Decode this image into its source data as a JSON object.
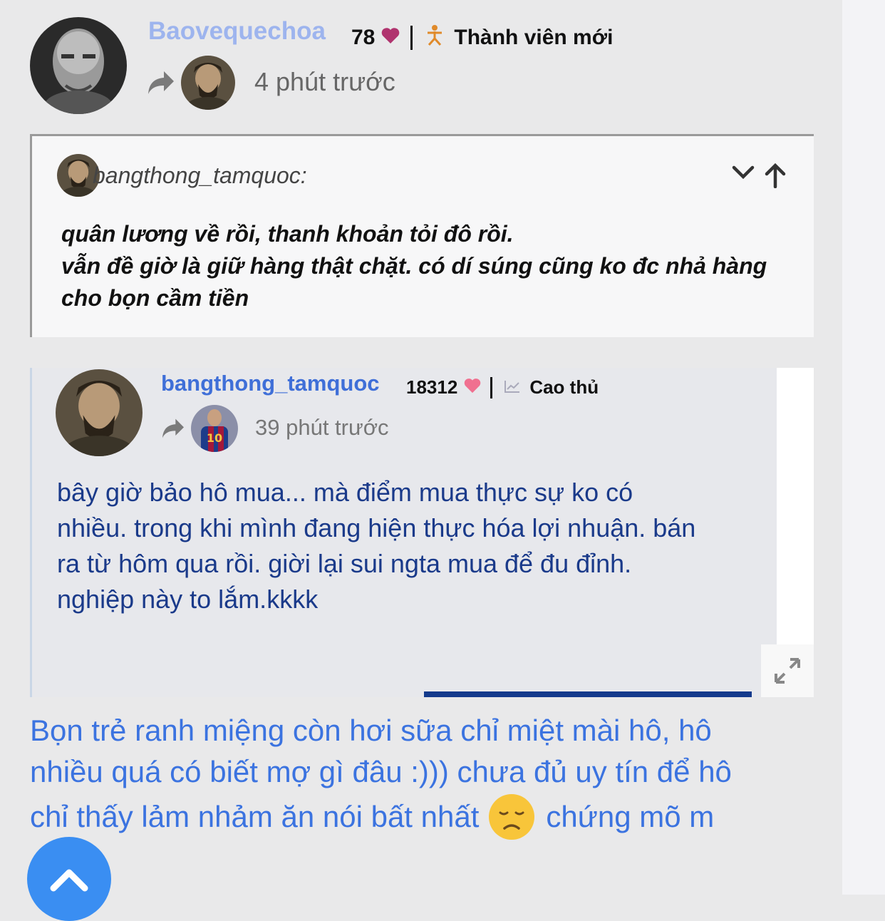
{
  "header": {
    "username": "Baovequechoa",
    "hearts": "78",
    "rank": "Thành viên mới",
    "time": "4 phút trước"
  },
  "quote": {
    "author": "bangthong_tamquoc:",
    "lines": [
      "quân lương về rồi, thanh khoản tỏi đô rồi.",
      "vẫn đề giờ là giữ hàng thật chặt. có dí súng cũng ko đc nhả hàng",
      "cho bọn cầm tiền"
    ]
  },
  "shared_post": {
    "username": "bangthong_tamquoc",
    "hearts": "18312",
    "rank": "Cao thủ",
    "time": "39 phút trước",
    "jersey_number": "10",
    "lines": [
      "bây giờ bảo hô mua... mà điểm mua thực sự ko có",
      "nhiều. trong khi mình đang hiện thực hóa lợi nhuận. bán",
      "ra từ hôm qua rồi. giời lại sui ngta mua để đu đỉnh.",
      "nghiệp này to lắm.kkkk"
    ]
  },
  "comment": {
    "line1": "Bọn trẻ ranh miệng còn hơi sữa chỉ miệt mài hô, hô",
    "line2": "nhiều quá có biết mợ gì đâu :))) chưa đủ uy tín để hô",
    "line3_before": "chỉ thấy lảm nhảm ăn nói bất nhất",
    "line3_after": "chứng mõ m"
  },
  "colors": {
    "username_header": "#9db4ee",
    "username_shared": "#3f6fd8",
    "heart_header": "#b0336e",
    "heart_shared": "#f07090",
    "post_text": "#1a3a8a",
    "comment_text": "#3b73e0",
    "scroll_button": "#3a8ef2"
  },
  "icons": {
    "share": "share-arrow-icon",
    "heart": "heart-icon",
    "rank_new": "new-member-icon",
    "rank_pro": "chart-icon",
    "collapse": "chevron-down-icon",
    "jump": "arrow-up-icon",
    "expand": "expand-icon",
    "emoji": "disappointed-face-emoji",
    "scroll_top": "chevron-up-icon"
  }
}
